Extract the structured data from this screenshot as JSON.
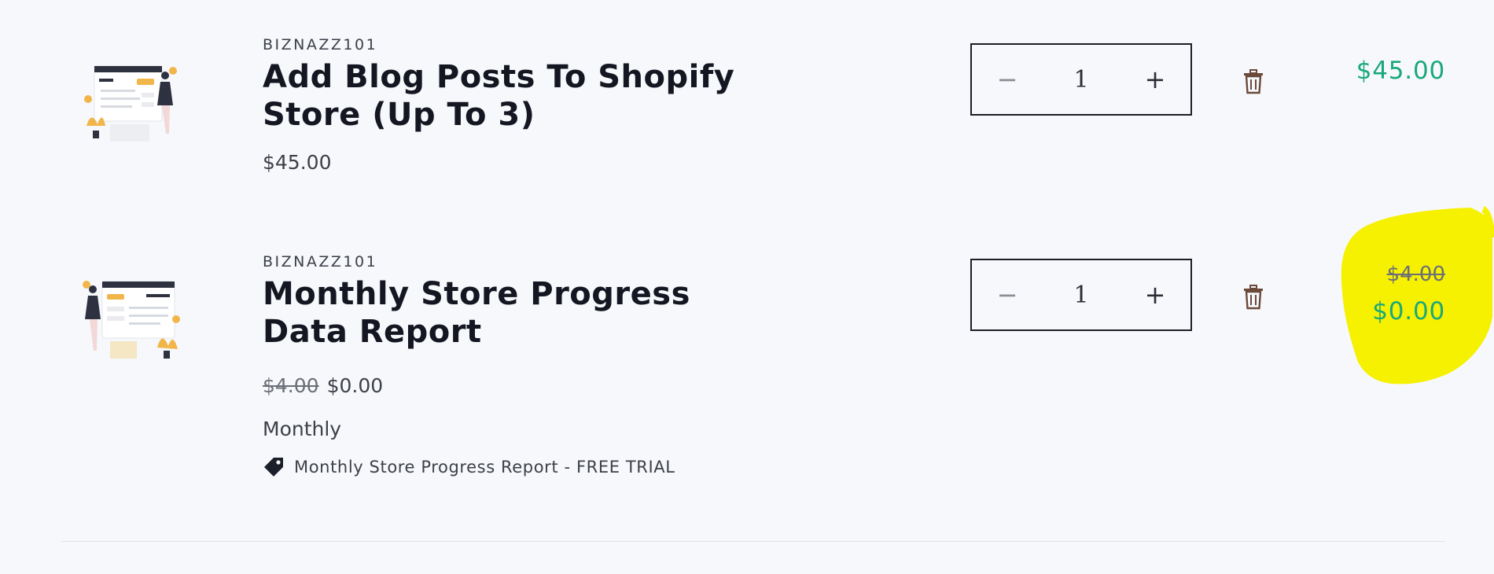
{
  "items": [
    {
      "vendor": "BIZNAZZ101",
      "title_line1": "Add Blog Posts To Shopify",
      "title_line2": "Store (Up To 3)",
      "price": "$45.00",
      "quantity": "1",
      "total": "$45.00"
    },
    {
      "vendor": "BIZNAZZ101",
      "title_line1": "Monthly Store Progress",
      "title_line2": "Data Report",
      "compare_price": "$4.00",
      "price": "$0.00",
      "plan": "Monthly",
      "discount_label": "Monthly Store Progress Report - FREE TRIAL",
      "quantity": "1",
      "total_was": "$4.00",
      "total": "$0.00"
    }
  ],
  "quantity_controls": {
    "minus": "−",
    "plus": "+"
  },
  "colors": {
    "accent_total": "#1aa87a",
    "highlight": "#f5f100",
    "trash": "#6b4a3a",
    "text": "#141722"
  },
  "icons": {
    "trash": "trash-icon",
    "discount": "price-tag-icon",
    "thumbnail": "product-illustration"
  }
}
